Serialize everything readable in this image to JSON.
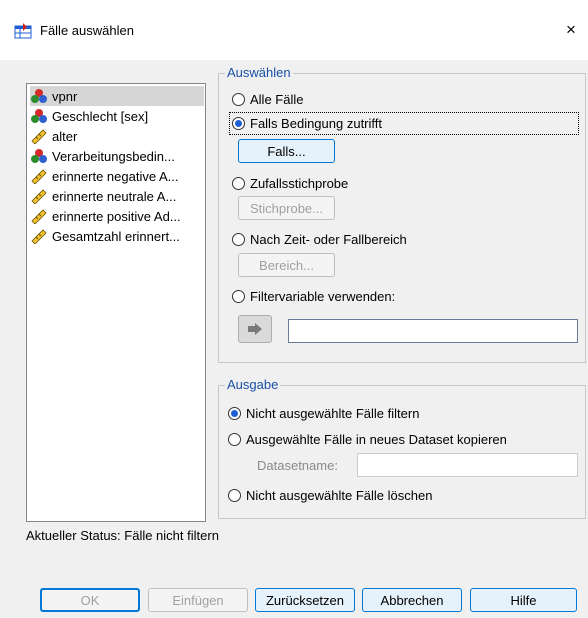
{
  "window": {
    "title": "Fälle auswählen",
    "close_glyph": "×"
  },
  "variables": [
    {
      "label": "vpnr",
      "type": "nominal"
    },
    {
      "label": "Geschlecht [sex]",
      "type": "nominal"
    },
    {
      "label": "alter",
      "type": "scale"
    },
    {
      "label": "Verarbeitungsbedin...",
      "type": "nominal"
    },
    {
      "label": "erinnerte negative A...",
      "type": "scale"
    },
    {
      "label": "erinnerte neutrale A...",
      "type": "scale"
    },
    {
      "label": "erinnerte positive Ad...",
      "type": "scale"
    },
    {
      "label": "Gesamtzahl erinnert...",
      "type": "scale"
    }
  ],
  "select_group": {
    "legend": "Auswählen",
    "all_cases": "Alle Fälle",
    "if_condition": "Falls Bedingung zutrifft",
    "if_button": "Falls...",
    "random_sample": "Zufallsstichprobe",
    "sample_button": "Stichprobe...",
    "time_range": "Nach Zeit- oder Fallbereich",
    "range_button": "Bereich...",
    "filter_var": "Filtervariable verwenden:",
    "selected_option": "if_condition"
  },
  "output_group": {
    "legend": "Ausgabe",
    "filter_out": "Nicht ausgewählte Fälle filtern",
    "copy_dataset": "Ausgewählte Fälle in neues Dataset kopieren",
    "dataset_name_label": "Datasetname:",
    "dataset_name_value": "",
    "delete_unselected": "Nicht ausgewählte Fälle löschen",
    "selected_option": "filter_out"
  },
  "status": {
    "text": "Aktueller Status: Fälle nicht filtern"
  },
  "buttons": {
    "ok": "OK",
    "paste": "Einfügen",
    "reset": "Zurücksetzen",
    "cancel": "Abbrechen",
    "help": "Hilfe"
  },
  "colors": {
    "accent": "#0078d7",
    "legend_text": "#1a4fa8",
    "dialog_bg": "#f0f0f0"
  }
}
